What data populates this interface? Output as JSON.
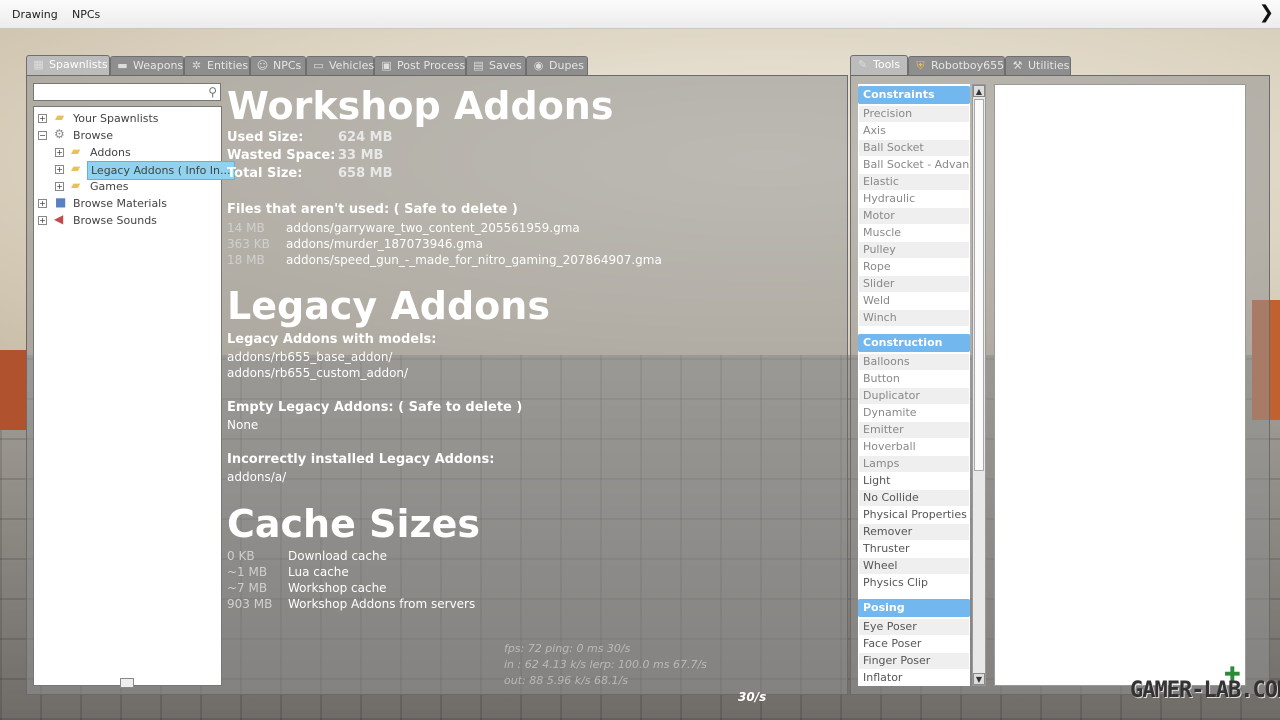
{
  "menubar": {
    "items": [
      "Drawing",
      "NPCs"
    ],
    "close_glyph": "❯"
  },
  "left_tabs": [
    {
      "label": "Spawnlists",
      "icon": "grid-icon"
    },
    {
      "label": "Weapons",
      "icon": "gun-icon"
    },
    {
      "label": "Entities",
      "icon": "atom-icon"
    },
    {
      "label": "NPCs",
      "icon": "face-icon"
    },
    {
      "label": "Vehicles",
      "icon": "car-icon"
    },
    {
      "label": "Post Process",
      "icon": "image-icon"
    },
    {
      "label": "Saves",
      "icon": "save-icon"
    },
    {
      "label": "Dupes",
      "icon": "dupes-icon"
    }
  ],
  "right_tabs": [
    {
      "label": "Tools",
      "icon": "wrench-icon"
    },
    {
      "label": "Robotboy655",
      "icon": "shield-icon"
    },
    {
      "label": "Utilities",
      "icon": "utilities-icon"
    }
  ],
  "tree": {
    "your_spawnlists": "Your Spawnlists",
    "browse": "Browse",
    "addons": "Addons",
    "legacy_addons": "Legacy Addons ( Info In...",
    "games": "Games",
    "browse_materials": "Browse Materials",
    "browse_sounds": "Browse Sounds"
  },
  "workshop": {
    "title": "Workshop Addons",
    "used_label": "Used Size:",
    "used_value": "624 MB",
    "wasted_label": "Wasted Space:",
    "wasted_value": "33 MB",
    "total_label": "Total Size:",
    "total_value": "658 MB",
    "unused_title": "Files that aren't used: ( Safe to delete )",
    "unused_files": [
      {
        "size": "14 MB",
        "path": "addons/garryware_two_content_205561959.gma"
      },
      {
        "size": "363 KB",
        "path": "addons/murder_187073946.gma"
      },
      {
        "size": "18 MB",
        "path": "addons/speed_gun_-_made_for_nitro_gaming_207864907.gma"
      }
    ]
  },
  "legacy": {
    "title": "Legacy Addons",
    "models_title": "Legacy Addons with models:",
    "models": [
      "addons/rb655_base_addon/",
      "addons/rb655_custom_addon/"
    ],
    "empty_title": "Empty Legacy Addons: ( Safe to delete )",
    "empty_value": "None",
    "incorrect_title": "Incorrectly installed Legacy Addons:",
    "incorrect_value": "addons/a/"
  },
  "cache": {
    "title": "Cache Sizes",
    "rows": [
      {
        "size": "0 KB",
        "label": "Download cache"
      },
      {
        "size": "~1 MB",
        "label": "Lua cache"
      },
      {
        "size": "~7 MB",
        "label": "Workshop cache"
      },
      {
        "size": "903 MB",
        "label": "Workshop Addons from servers"
      }
    ]
  },
  "netstats": {
    "line1": "fps:  72   ping: 0 ms                    30/s",
    "line2": "in :  62   4.13 k/s   lerp: 100.0 ms   67.7/s",
    "line3": "out:  88   5.96 k/s                    68.1/s"
  },
  "fps_center": "30/s",
  "tools": {
    "constraints": {
      "title": "Constraints",
      "items": [
        "Precision",
        "Axis",
        "Ball Socket",
        "Ball Socket - Advan...",
        "Elastic",
        "Hydraulic",
        "Motor",
        "Muscle",
        "Pulley",
        "Rope",
        "Slider",
        "Weld",
        "Winch"
      ]
    },
    "construction": {
      "title": "Construction",
      "items": [
        "Balloons",
        "Button",
        "Duplicator",
        "Dynamite",
        "Emitter",
        "Hoverball",
        "Lamps",
        "Light",
        "No Collide",
        "Physical Properties",
        "Remover",
        "Thruster",
        "Wheel",
        "Physics Clip"
      ]
    },
    "posing": {
      "title": "Posing",
      "items": [
        "Eye Poser",
        "Face Poser",
        "Finger Poser",
        "Inflator"
      ]
    }
  },
  "watermark": "GAMER-LAB.COM",
  "colors": {
    "category": "#72b8ee",
    "selection": "#8fd3f0"
  }
}
